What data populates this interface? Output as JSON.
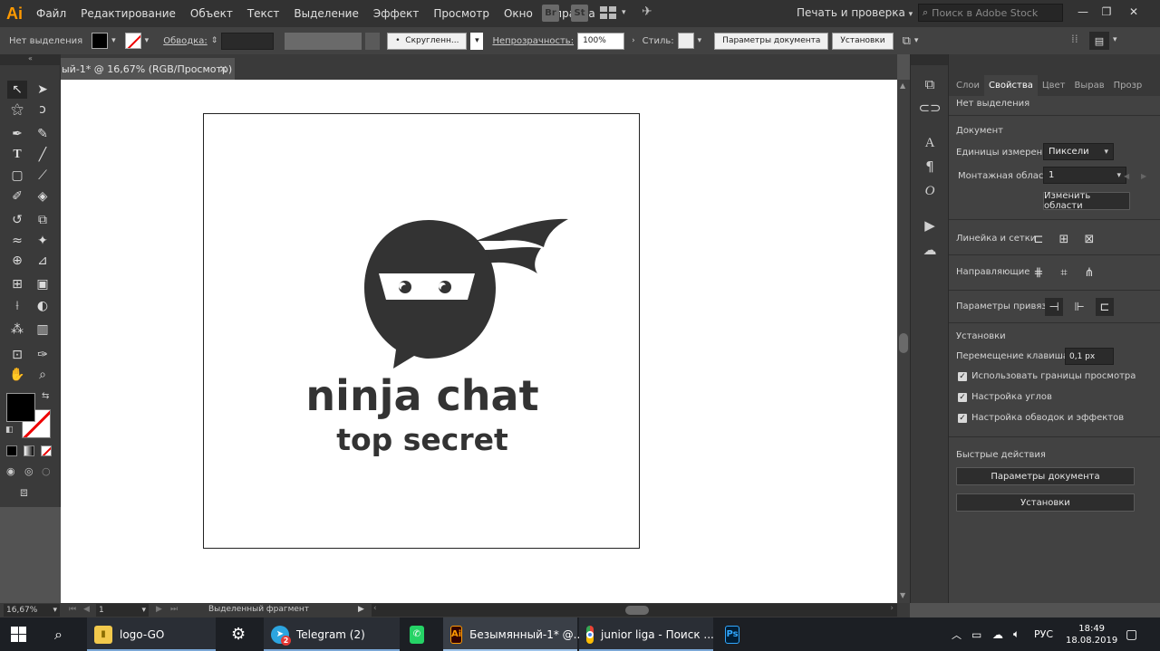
{
  "app": {
    "logo": "Ai",
    "menu": [
      "Файл",
      "Редактирование",
      "Объект",
      "Текст",
      "Выделение",
      "Эффект",
      "Просмотр",
      "Окно",
      "Справка"
    ],
    "bridge_badge": "Br",
    "stock_badge": "St",
    "workspace": "Печать и проверка",
    "search_placeholder": "Поиск в Adobe Stock",
    "window_min": "—",
    "window_restore": "❐",
    "window_close": "✕"
  },
  "controlbar": {
    "selection_label": "Нет выделения",
    "stroke_label": "Обводка:",
    "brush_label": "Скругленн...",
    "opacity_label": "Непрозрачность:",
    "opacity_value": "100%",
    "style_label": "Стиль:",
    "doc_params_button": "Параметры документа",
    "settings_button": "Установки"
  },
  "document": {
    "tab_title": "ый-1* @ 16,67% (RGB/Просмотр)",
    "tab_close": "✕",
    "logo_title": "ninja chat",
    "logo_subtitle": "top secret"
  },
  "panel": {
    "tabs": [
      "Слои",
      "Свойства",
      "Цвет",
      "Вырав",
      "Прозр"
    ],
    "active_tab": "Свойства",
    "no_selection": "Нет выделения",
    "document_section": "Документ",
    "units_label": "Единицы измерения:",
    "units_value": "Пиксели",
    "artboard_label": "Монтажная область:",
    "artboard_value": "1",
    "edit_artboards_button": "Изменить области",
    "rulers_label": "Линейка и сетки",
    "guides_label": "Направляющие",
    "snap_label": "Параметры привязки",
    "settings_section": "Установки",
    "keyboard_increment_label": "Перемещение клавишами:",
    "keyboard_increment_value": "0,1 px",
    "check_preview_bounds": "Использовать границы просмотра",
    "check_scale_corners": "Настройка углов",
    "check_scale_strokes": "Настройка обводок и эффектов",
    "quick_actions": "Быстрые действия",
    "quick_doc_params": "Параметры документа",
    "quick_settings": "Установки"
  },
  "status": {
    "zoom": "16,67%",
    "artboard_number": "1",
    "selection_info": "Выделенный фрагмент"
  },
  "taskbar": {
    "file_explorer_label": "logo-GO",
    "telegram_label": "Telegram (2)",
    "telegram_badge": "2",
    "illustrator_label": "Безымянный-1* @...",
    "chrome_label": "junior liga - Поиск ...",
    "language": "РУС",
    "time": "18:49",
    "date": "18.08.2019"
  }
}
